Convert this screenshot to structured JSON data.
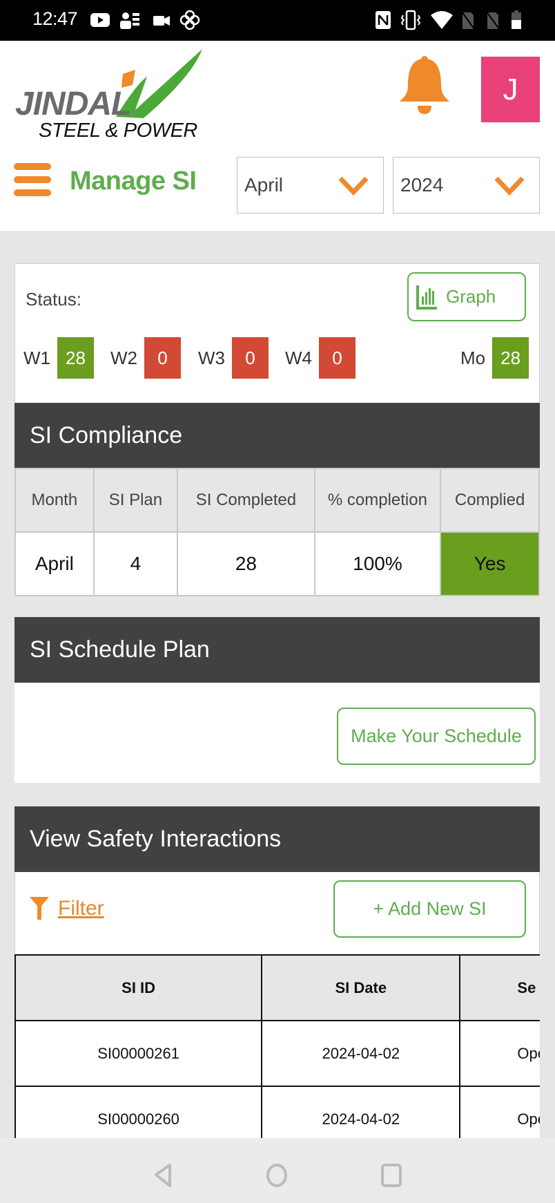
{
  "status_bar": {
    "time": "12:47",
    "left_icons": [
      "youtube-icon",
      "contacts-app-icon",
      "video-camera-icon",
      "pinwheel-icon"
    ],
    "right_icons": [
      "nfc-icon",
      "vibrate-icon",
      "wifi-icon",
      "no-sim-icon",
      "no-sim-icon",
      "battery-icon"
    ]
  },
  "header": {
    "logo_line1": "JINDAL",
    "logo_line2": "STEEL & POWER",
    "notification_icon": "bell-icon",
    "avatar_initial": "J",
    "menu_icon": "hamburger-icon",
    "page_title": "Manage SI",
    "month_select": {
      "value": "April"
    },
    "year_select": {
      "value": "2024"
    }
  },
  "status_card": {
    "label": "Status:",
    "graph_button": "Graph",
    "weeks": [
      {
        "label": "W1",
        "value": "28",
        "state": "ok"
      },
      {
        "label": "W2",
        "value": "0",
        "state": "bad"
      },
      {
        "label": "W3",
        "value": "0",
        "state": "bad"
      },
      {
        "label": "W4",
        "value": "0",
        "state": "bad"
      }
    ],
    "month": {
      "label": "Mo",
      "value": "28",
      "state": "ok"
    }
  },
  "compliance": {
    "title": "SI Compliance",
    "headers": [
      "Month",
      "SI Plan",
      "SI Completed",
      "% completion",
      "Complied"
    ],
    "row": [
      "April",
      "4",
      "28",
      "100%",
      "Yes"
    ]
  },
  "schedule": {
    "title": "SI Schedule Plan",
    "button": "Make Your Schedule"
  },
  "safety_interactions": {
    "title": "View Safety Interactions",
    "filter_label": "Filter",
    "add_button": "+ Add New SI",
    "headers": [
      "SI ID",
      "SI Date",
      "Se"
    ],
    "rows": [
      [
        "SI00000261",
        "2024-04-02",
        "Ope"
      ],
      [
        "SI00000260",
        "2024-04-02",
        "Ope"
      ]
    ]
  },
  "colors": {
    "brand_green": "#5fad4e",
    "brand_orange": "#f0892a",
    "ok_badge": "#6a9e1f",
    "bad_badge": "#d24a35",
    "header_dark": "#414143",
    "avatar_pink": "#e9417a"
  }
}
